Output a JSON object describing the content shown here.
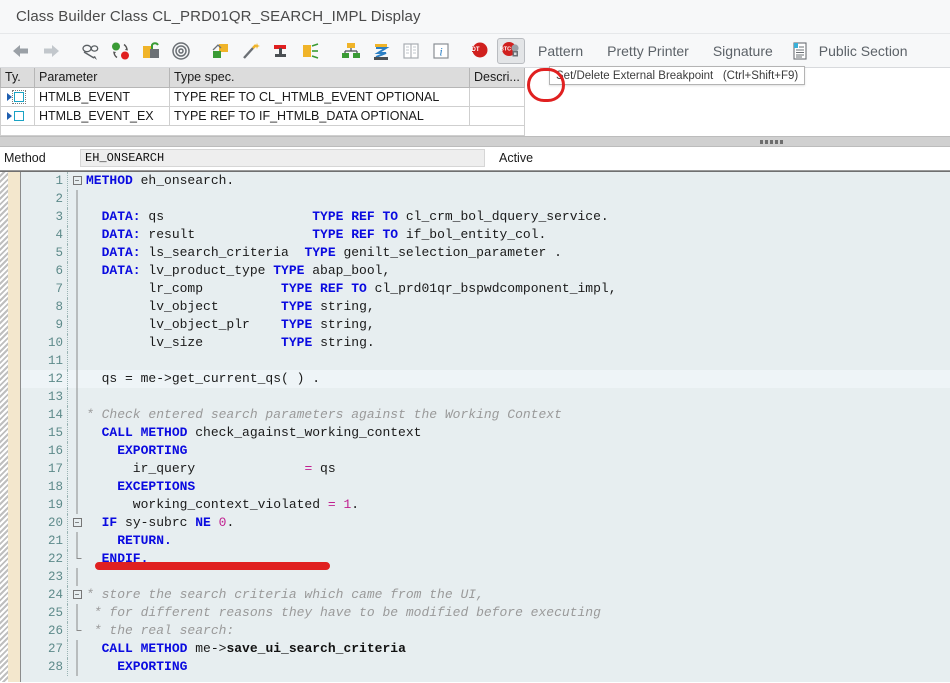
{
  "window": {
    "title": "Class Builder Class CL_PRD01QR_SEARCH_IMPL Display"
  },
  "toolbar": {
    "back_label": "Back",
    "forward_label": "Forward",
    "display_change_label": "Display <-> Change",
    "other_object_label": "Other Object",
    "check_label": "Check",
    "activate_label": "Activate",
    "where_used_label": "Where-Used List",
    "pattern_icon_label": "Insert Statement",
    "cut_label": "Cut",
    "copy_label": "Copy",
    "class_hierarchy_label": "Class Hierarchy",
    "local_types_label": "Local Types",
    "display_object_list_label": "Display Object List",
    "info_label": "Information",
    "delete_breakpoint_label": "Delete Breakpoint",
    "set_breakpoint_label": "Set/Delete External Breakpoint",
    "pattern_label": "Pattern",
    "pretty_printer_label": "Pretty Printer",
    "signature_label": "Signature",
    "public_section_label": "Public Section",
    "tooltip_text": "Set/Delete External Breakpoint   (Ctrl+Shift+F9)",
    "accent_red": "#e02020"
  },
  "parameters": {
    "headers": [
      "Ty.",
      "Parameter",
      "Type spec.",
      "Descri..."
    ],
    "rows": [
      {
        "type_icon": "importing-parameter-icon",
        "parameter": "HTMLB_EVENT",
        "type_spec": "TYPE REF TO CL_HTMLB_EVENT OPTIONAL",
        "description": ""
      },
      {
        "type_icon": "importing-parameter-icon",
        "parameter": "HTMLB_EVENT_EX",
        "type_spec": "TYPE REF TO IF_HTMLB_DATA OPTIONAL",
        "description": ""
      }
    ]
  },
  "method_bar": {
    "label": "Method",
    "value": "EH_ONSEARCH",
    "status": "Active"
  },
  "code": {
    "highlighted_line": 12,
    "lines": [
      {
        "n": 1,
        "fold": "open",
        "bar": false,
        "tokens": [
          [
            "kw",
            "METHOD"
          ],
          [
            "id",
            " eh_onsearch."
          ]
        ]
      },
      {
        "n": 2,
        "fold": "",
        "bar": true,
        "tokens": []
      },
      {
        "n": 3,
        "fold": "",
        "bar": true,
        "tokens": [
          [
            "kw",
            "  DATA:"
          ],
          [
            "id",
            " qs                   "
          ],
          [
            "kw",
            "TYPE REF TO"
          ],
          [
            "id",
            " cl_crm_bol_dquery_service."
          ]
        ]
      },
      {
        "n": 4,
        "fold": "",
        "bar": true,
        "tokens": [
          [
            "kw",
            "  DATA:"
          ],
          [
            "id",
            " result               "
          ],
          [
            "kw",
            "TYPE REF TO"
          ],
          [
            "id",
            " if_bol_entity_col."
          ]
        ]
      },
      {
        "n": 5,
        "fold": "",
        "bar": true,
        "tokens": [
          [
            "kw",
            "  DATA:"
          ],
          [
            "id",
            " ls_search_criteria  "
          ],
          [
            "kw",
            "TYPE"
          ],
          [
            "id",
            " genilt_selection_parameter ."
          ]
        ]
      },
      {
        "n": 6,
        "fold": "",
        "bar": true,
        "tokens": [
          [
            "kw",
            "  DATA:"
          ],
          [
            "id",
            " lv_product_type "
          ],
          [
            "kw",
            "TYPE"
          ],
          [
            "id",
            " abap_bool,"
          ]
        ]
      },
      {
        "n": 7,
        "fold": "",
        "bar": true,
        "tokens": [
          [
            "id",
            "        lr_comp          "
          ],
          [
            "kw",
            "TYPE REF TO"
          ],
          [
            "id",
            " cl_prd01qr_bspwdcomponent_impl,"
          ]
        ]
      },
      {
        "n": 8,
        "fold": "",
        "bar": true,
        "tokens": [
          [
            "id",
            "        lv_object        "
          ],
          [
            "kw",
            "TYPE"
          ],
          [
            "id",
            " string,"
          ]
        ]
      },
      {
        "n": 9,
        "fold": "",
        "bar": true,
        "tokens": [
          [
            "id",
            "        lv_object_plr    "
          ],
          [
            "kw",
            "TYPE"
          ],
          [
            "id",
            " string,"
          ]
        ]
      },
      {
        "n": 10,
        "fold": "",
        "bar": true,
        "tokens": [
          [
            "id",
            "        lv_size          "
          ],
          [
            "kw",
            "TYPE"
          ],
          [
            "id",
            " string."
          ]
        ]
      },
      {
        "n": 11,
        "fold": "",
        "bar": true,
        "tokens": []
      },
      {
        "n": 12,
        "fold": "",
        "bar": true,
        "tokens": [
          [
            "id",
            "  qs = me->get_current_qs( ) ."
          ]
        ]
      },
      {
        "n": 13,
        "fold": "",
        "bar": true,
        "tokens": []
      },
      {
        "n": 14,
        "fold": "",
        "bar": true,
        "tokens": [
          [
            "cmt",
            "* Check entered search parameters against the Working Context"
          ]
        ]
      },
      {
        "n": 15,
        "fold": "",
        "bar": true,
        "tokens": [
          [
            "kw",
            "  CALL METHOD"
          ],
          [
            "id",
            " check_against_working_context"
          ]
        ]
      },
      {
        "n": 16,
        "fold": "",
        "bar": true,
        "tokens": [
          [
            "kw",
            "    EXPORTING"
          ]
        ]
      },
      {
        "n": 17,
        "fold": "",
        "bar": true,
        "tokens": [
          [
            "id",
            "      ir_query              "
          ],
          [
            "op",
            "= "
          ],
          [
            "id",
            "qs"
          ]
        ]
      },
      {
        "n": 18,
        "fold": "",
        "bar": true,
        "tokens": [
          [
            "kw",
            "    EXCEPTIONS"
          ]
        ]
      },
      {
        "n": 19,
        "fold": "",
        "bar": true,
        "tokens": [
          [
            "id",
            "      working_context_violated "
          ],
          [
            "op",
            "= "
          ],
          [
            "num",
            "1"
          ],
          [
            "id",
            "."
          ]
        ]
      },
      {
        "n": 20,
        "fold": "open",
        "bar": false,
        "tokens": [
          [
            "kw",
            "  IF"
          ],
          [
            "id",
            " sy-subrc "
          ],
          [
            "kw",
            "NE"
          ],
          [
            "num",
            " 0"
          ],
          [
            "id",
            "."
          ]
        ]
      },
      {
        "n": 21,
        "fold": "",
        "bar": true,
        "tokens": [
          [
            "kw",
            "    RETURN."
          ]
        ]
      },
      {
        "n": 22,
        "fold": "end",
        "bar": false,
        "tokens": [
          [
            "kw",
            "  ENDIF."
          ]
        ]
      },
      {
        "n": 23,
        "fold": "",
        "bar": true,
        "tokens": []
      },
      {
        "n": 24,
        "fold": "open",
        "bar": false,
        "tokens": [
          [
            "cmt",
            "* store the search criteria which came from the UI,"
          ]
        ]
      },
      {
        "n": 25,
        "fold": "",
        "bar": true,
        "tokens": [
          [
            "cmt",
            " * for different reasons they have to be modified before executing"
          ]
        ]
      },
      {
        "n": 26,
        "fold": "end",
        "bar": false,
        "tokens": [
          [
            "cmt",
            " * the real search:"
          ]
        ]
      },
      {
        "n": 27,
        "fold": "",
        "bar": true,
        "tokens": [
          [
            "kw",
            "  CALL METHOD"
          ],
          [
            "id",
            " me->"
          ],
          [
            "meth",
            "save_ui_search_criteria"
          ]
        ]
      },
      {
        "n": 28,
        "fold": "",
        "bar": true,
        "tokens": [
          [
            "kw",
            "    EXPORTING"
          ]
        ]
      }
    ]
  }
}
